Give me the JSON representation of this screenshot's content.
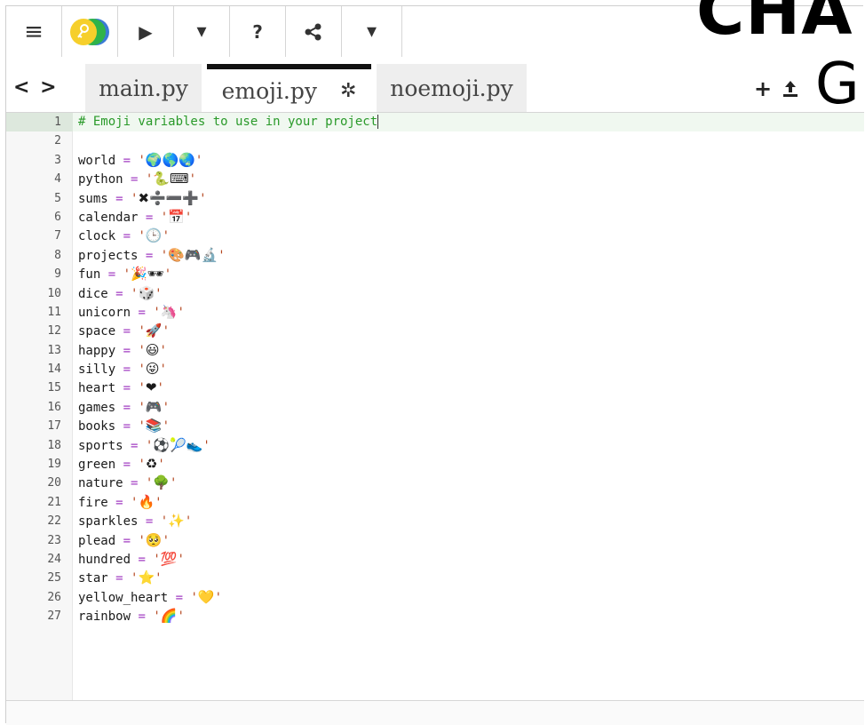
{
  "toolbar": {
    "menu_icon": "≡",
    "key_icon": "key-icon",
    "run_icon": "▶",
    "dropdown1_icon": "▾",
    "help_label": "?",
    "share_icon": "share-icon",
    "dropdown2_icon": "▾"
  },
  "overlay": {
    "top_text": "CHA",
    "side_text": "G"
  },
  "tabs": {
    "nav_left": "<",
    "nav_right": ">",
    "items": [
      {
        "label": "main.py",
        "active": false
      },
      {
        "label": "emoji.py",
        "active": true
      },
      {
        "label": "noemoji.py",
        "active": false
      }
    ],
    "gear_icon": "✲",
    "add_label": "+",
    "upload_icon": "upload-icon"
  },
  "editor": {
    "comment": "# Emoji variables to use in your project",
    "lines": [
      {
        "n": "1"
      },
      {
        "n": "2"
      },
      {
        "n": "3",
        "name": "world",
        "value": "🌍🌎🌏"
      },
      {
        "n": "4",
        "name": "python",
        "value": "🐍⌨"
      },
      {
        "n": "5",
        "name": "sums",
        "value": "✖➗➖➕"
      },
      {
        "n": "6",
        "name": "calendar",
        "value": "📅"
      },
      {
        "n": "7",
        "name": "clock",
        "value": "🕒"
      },
      {
        "n": "8",
        "name": "projects",
        "value": "🎨🎮🔬"
      },
      {
        "n": "9",
        "name": "fun",
        "value": "🎉🕶"
      },
      {
        "n": "10",
        "name": "dice",
        "value": "🎲"
      },
      {
        "n": "11",
        "name": "unicorn",
        "value": "🦄"
      },
      {
        "n": "12",
        "name": "space",
        "value": "🚀"
      },
      {
        "n": "13",
        "name": "happy",
        "value": "😃"
      },
      {
        "n": "14",
        "name": "silly",
        "value": "😜"
      },
      {
        "n": "15",
        "name": "heart",
        "value": "❤"
      },
      {
        "n": "16",
        "name": "games",
        "value": "🎮"
      },
      {
        "n": "17",
        "name": "books",
        "value": "📚"
      },
      {
        "n": "18",
        "name": "sports",
        "value": "⚽🎾👟"
      },
      {
        "n": "19",
        "name": "green",
        "value": "♻"
      },
      {
        "n": "20",
        "name": "nature",
        "value": "🌳"
      },
      {
        "n": "21",
        "name": "fire",
        "value": "🔥"
      },
      {
        "n": "22",
        "name": "sparkles",
        "value": "✨"
      },
      {
        "n": "23",
        "name": "plead",
        "value": "🥺"
      },
      {
        "n": "24",
        "name": "hundred",
        "value": "💯"
      },
      {
        "n": "25",
        "name": "star",
        "value": "⭐"
      },
      {
        "n": "26",
        "name": "yellow_heart",
        "value": "💛"
      },
      {
        "n": "27",
        "name": "rainbow",
        "value": "🌈"
      }
    ]
  }
}
